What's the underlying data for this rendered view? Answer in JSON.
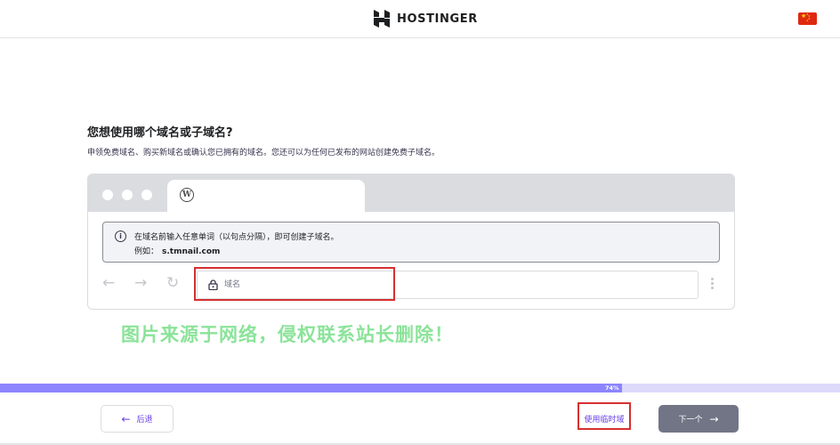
{
  "header": {
    "brand": "HOSTINGER",
    "language_flag": "cn-flag-icon"
  },
  "main": {
    "title": "您想使用哪个域名或子域名?",
    "subtitle": "申领免费域名、购买新域名或确认您已拥有的域名。您还可以为任何已发布的网站创建免费子域名。"
  },
  "browser": {
    "info_line1": "在域名前输入任意单词（以句点分隔），即可创建子域名。",
    "example_label": "例如：",
    "example_value": "s.tmnail.com",
    "url_placeholder": "域名",
    "url_value": ""
  },
  "watermark": "图片来源于网络，侵权联系站长删除！",
  "progress": {
    "percent": 74,
    "label": "74%"
  },
  "footer": {
    "back_label": "后退",
    "temp_domain_label": "使用临时域",
    "next_label": "下一个"
  },
  "colors": {
    "accent": "#673de6",
    "progress_fill": "#8c85ff",
    "progress_track": "#dcd9fb",
    "next_button": "#727586",
    "highlight": "#d63030"
  }
}
